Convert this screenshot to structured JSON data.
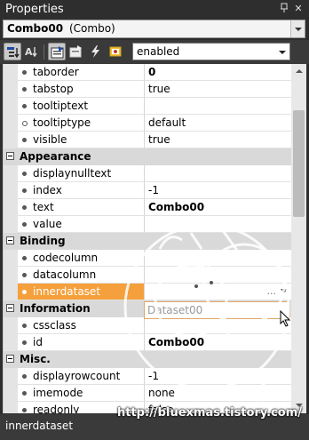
{
  "window": {
    "title": "Properties",
    "pin_glyph": "ᴾ",
    "close_glyph": "✕"
  },
  "object": {
    "name": "Combo00",
    "type": "(Combo)"
  },
  "toolbar": {
    "filter_value": "enabled",
    "buttons": [
      "sort-category-icon",
      "sort-alpha-icon",
      "properties-icon",
      "property-pages-icon",
      "events-icon",
      "settings-icon"
    ]
  },
  "grid": {
    "rows": [
      {
        "kind": "prop",
        "name": "taborder",
        "value": "0",
        "bold": true
      },
      {
        "kind": "prop",
        "name": "tabstop",
        "value": "true"
      },
      {
        "kind": "prop",
        "name": "tooltiptext",
        "value": ""
      },
      {
        "kind": "prop",
        "name": "tooltiptype",
        "value": "default",
        "hollow": true
      },
      {
        "kind": "prop",
        "name": "visible",
        "value": "true"
      },
      {
        "kind": "cat",
        "name": "Appearance"
      },
      {
        "kind": "prop",
        "name": "displaynulltext",
        "value": ""
      },
      {
        "kind": "prop",
        "name": "index",
        "value": "-1"
      },
      {
        "kind": "prop",
        "name": "text",
        "value": "Combo00",
        "bold": true
      },
      {
        "kind": "prop",
        "name": "value",
        "value": ""
      },
      {
        "kind": "cat",
        "name": "Binding"
      },
      {
        "kind": "prop",
        "name": "codecolumn",
        "value": ""
      },
      {
        "kind": "prop",
        "name": "datacolumn",
        "value": ""
      },
      {
        "kind": "prop",
        "name": "innerdataset",
        "value": "",
        "selected": true
      },
      {
        "kind": "cat",
        "name": "Information"
      },
      {
        "kind": "prop",
        "name": "cssclass",
        "value": ""
      },
      {
        "kind": "prop",
        "name": "id",
        "value": "Combo00",
        "bold": true
      },
      {
        "kind": "cat",
        "name": "Misc."
      },
      {
        "kind": "prop",
        "name": "displayrowcount",
        "value": "-1"
      },
      {
        "kind": "prop",
        "name": "imemode",
        "value": "none"
      },
      {
        "kind": "prop",
        "name": "readonly",
        "value": "false"
      }
    ],
    "editor": {
      "ellipsis": "...",
      "dropdown_option": "Dataset00"
    }
  },
  "status": {
    "text": "innerdataset"
  },
  "watermark": "http://bluexmas.tistory.com/",
  "colors": {
    "selected": "#f5a03c",
    "category_bg": "#d9d9d9",
    "panel": "#2d2d2d"
  }
}
